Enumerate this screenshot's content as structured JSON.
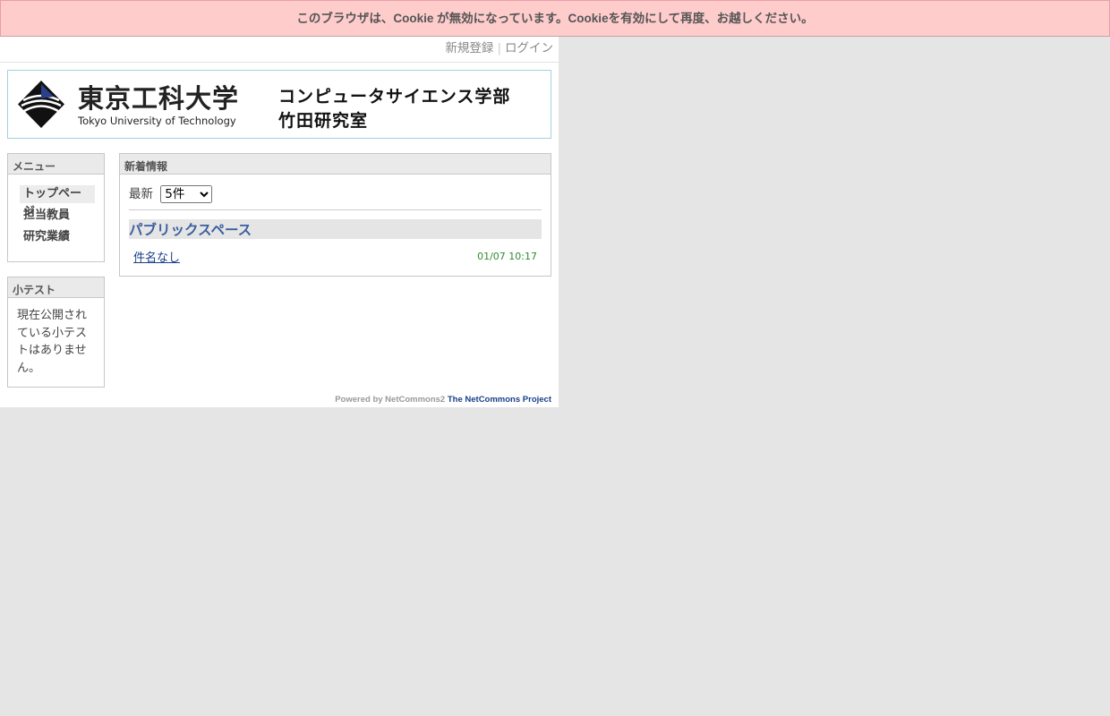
{
  "cookie_notice": "このブラウザは、Cookie が無効になっています。Cookieを有効にして再度、お越しください。",
  "login_bar": {
    "register": "新規登録",
    "separator": "|",
    "login": "ログイン"
  },
  "banner": {
    "university_ja": "東京工科大学",
    "university_en": "Tokyo University of Technology",
    "department": "コンピュータサイエンス学部",
    "lab": "竹田研究室"
  },
  "menu": {
    "title": "メニュー",
    "items": [
      {
        "label": "トップページ",
        "active": true
      },
      {
        "label": "担当教員"
      },
      {
        "label": "研究業績"
      }
    ]
  },
  "quiz": {
    "title": "小テスト",
    "message": "現在公開されている小テストはありません。"
  },
  "news": {
    "title": "新着情報",
    "latest_label": "最新",
    "count_selected": "5件",
    "space_name": "パブリックスペース",
    "entries": [
      {
        "title": "件名なし",
        "date": "01/07 10:17"
      }
    ]
  },
  "footer": {
    "powered_by": "Powered by NetCommons2",
    "project": "The NetCommons Project"
  },
  "colors": {
    "cookie_bg": "#ffcccc",
    "link": "#1a3f8a",
    "space_header": "#3a5ea0",
    "date": "#2e8b2e"
  },
  "icons": {
    "logo": "university-logo-icon"
  }
}
